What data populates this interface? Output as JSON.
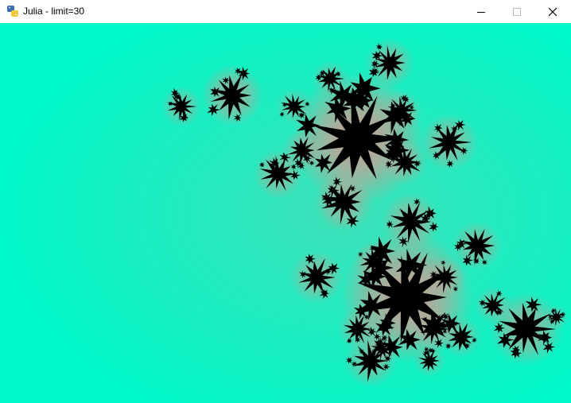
{
  "window": {
    "title": "Julia - limit=30",
    "icon": "python-icon",
    "controls": {
      "minimize": "minimize-icon",
      "maximize": "maximize-icon",
      "close": "close-icon"
    }
  },
  "render": {
    "fractal": "julia-set",
    "iteration_limit": 30,
    "colors": {
      "background": "#00f7c8",
      "glow": "#e4948c",
      "interior": "#000000"
    }
  }
}
